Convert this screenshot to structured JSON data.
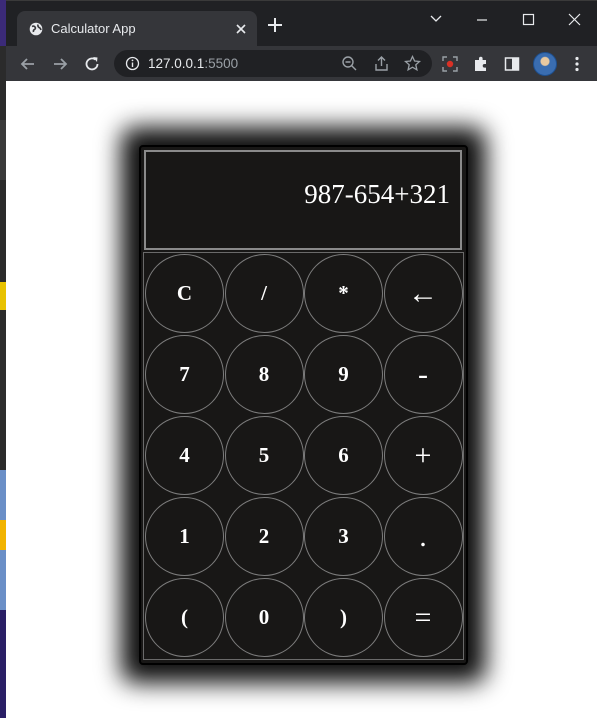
{
  "tab": {
    "title": "Calculator App"
  },
  "omnibox": {
    "host": "127.0.0.1",
    "port": ":5500"
  },
  "calculator": {
    "display": "987-654+321",
    "keys": [
      [
        "C",
        "/",
        "*",
        "←"
      ],
      [
        "7",
        "8",
        "9",
        "-"
      ],
      [
        "4",
        "5",
        "6",
        "+"
      ],
      [
        "1",
        "2",
        "3",
        "."
      ],
      [
        "(",
        "0",
        ")",
        "="
      ]
    ]
  },
  "colors": {
    "chrome_dark": "#202124",
    "chrome_toolbar": "#35363a",
    "calc_bg": "#181716",
    "key_border": "#7c7c7c",
    "text": "#ffffff"
  }
}
